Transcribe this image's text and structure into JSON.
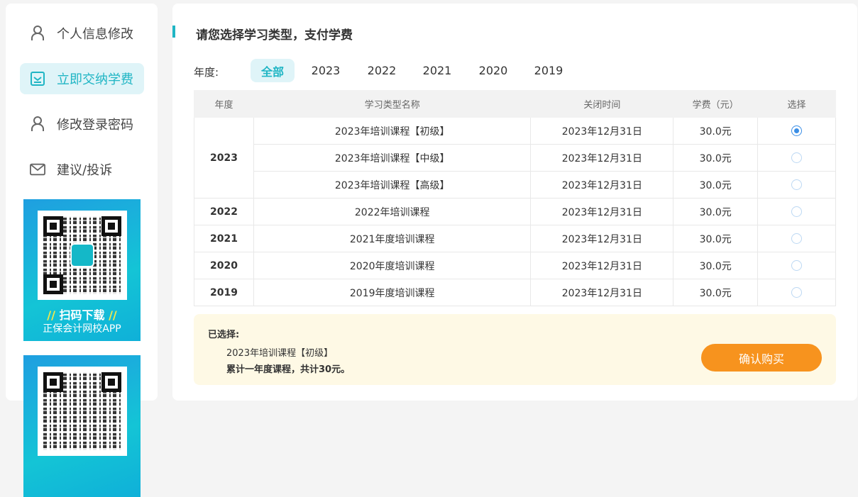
{
  "sidebar": {
    "items": [
      {
        "label": "个人信息修改",
        "icon": "user-icon"
      },
      {
        "label": "立即交纳学费",
        "icon": "checkbox-icon",
        "active": true
      },
      {
        "label": "修改登录密码",
        "icon": "user-icon"
      },
      {
        "label": "建议/投诉",
        "icon": "mail-icon"
      }
    ],
    "promo": {
      "title": "扫码下载",
      "subtitle": "正保会计网校APP"
    }
  },
  "main": {
    "title": "请您选择学习类型，支付学费",
    "year_label": "年度:",
    "years": [
      "全部",
      "2023",
      "2022",
      "2021",
      "2020",
      "2019"
    ],
    "selected_year": "全部",
    "table": {
      "headers": [
        "年度",
        "学习类型名称",
        "关闭时间",
        "学费（元）",
        "选择"
      ],
      "rows": [
        {
          "year": "2023",
          "name": "2023年培训课程【初级】",
          "close": "2023年12月31日",
          "fee": "30.0元",
          "selected": true
        },
        {
          "year": "2023",
          "name": "2023年培训课程【中级】",
          "close": "2023年12月31日",
          "fee": "30.0元",
          "selected": false
        },
        {
          "year": "2023",
          "name": "2023年培训课程【高级】",
          "close": "2023年12月31日",
          "fee": "30.0元",
          "selected": false
        },
        {
          "year": "2022",
          "name": "2022年培训课程",
          "close": "2023年12月31日",
          "fee": "30.0元",
          "selected": false
        },
        {
          "year": "2021",
          "name": "2021年度培训课程",
          "close": "2023年12月31日",
          "fee": "30.0元",
          "selected": false
        },
        {
          "year": "2020",
          "name": "2020年度培训课程",
          "close": "2023年12月31日",
          "fee": "30.0元",
          "selected": false
        },
        {
          "year": "2019",
          "name": "2019年度培训课程",
          "close": "2023年12月31日",
          "fee": "30.0元",
          "selected": false
        }
      ]
    },
    "summary": {
      "label": "已选择:",
      "course": "2023年培训课程【初级】",
      "total": "累计一年度课程，共计30元。",
      "confirm": "确认购买"
    }
  },
  "colors": {
    "accent": "#1fb5c4",
    "button": "#f7931e",
    "summary_bg": "#fef9e5"
  }
}
